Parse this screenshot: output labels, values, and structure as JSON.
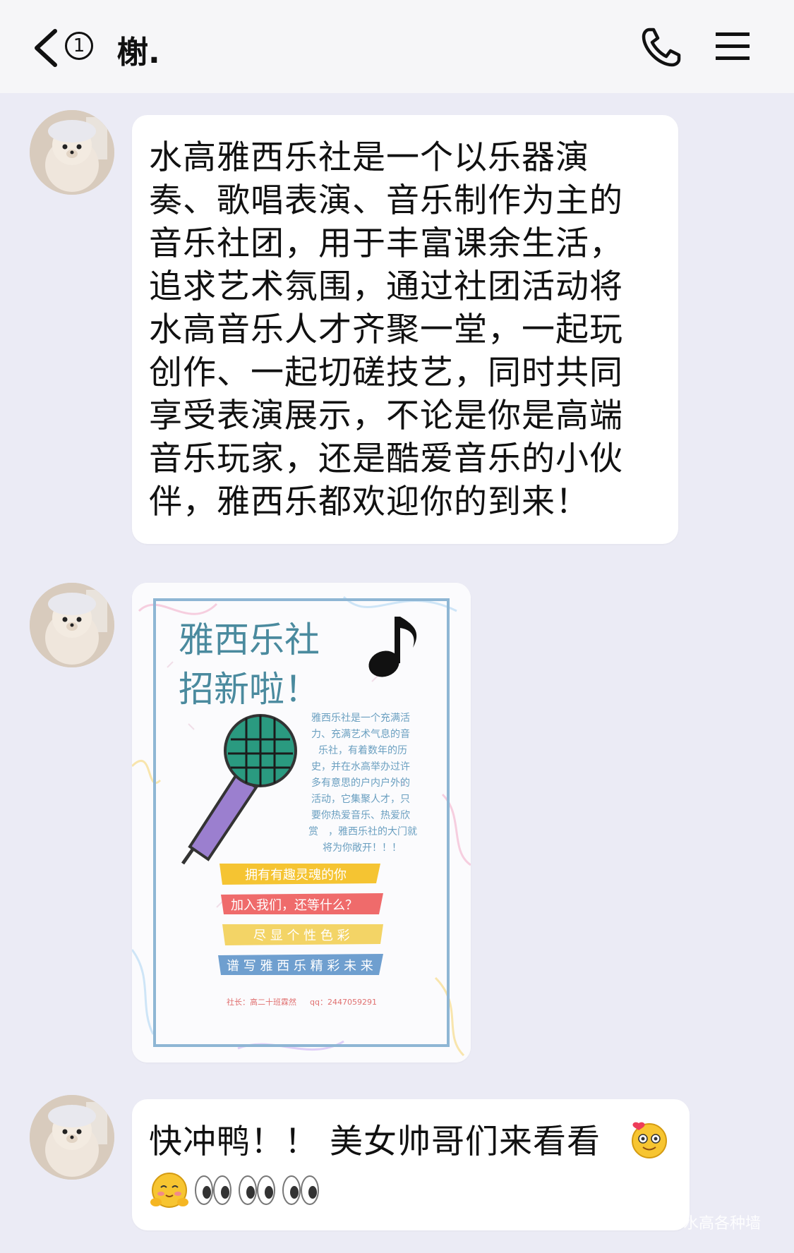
{
  "header": {
    "unread_count": "1",
    "title": "榭."
  },
  "messages": [
    {
      "type": "text",
      "lines": [
        "水高雅西乐社是一个以乐器演",
        "奏、歌唱表演、音乐制作为主的",
        "音乐社团，用于丰富课余生活，",
        "追求艺术氛围，通过社团活动将",
        "水高音乐人才齐聚一堂，一起玩",
        "创作、一起切磋技艺，同时共同",
        "享受表演展示，不论是你是高端",
        "音乐玩家，还是酷爱音乐的小伙",
        "伴，雅西乐都欢迎你的到来！"
      ]
    },
    {
      "type": "image",
      "poster": {
        "title_line1": "雅西乐社",
        "title_line2": "招新啦！",
        "intro_lines": [
          "雅西乐社是一个充满活",
          "力、充满艺术气息的音",
          "乐社，有着数年的历",
          "史，并在水高举办过许",
          "多有意思的户内户外的",
          "活动，它集聚人才，只",
          "要你热爱音乐、热爱欣",
          "赏　，雅西乐社的大门就",
          "将为你敞开！！！"
        ],
        "ribbons": [
          {
            "text": "拥有有趣灵魂的你",
            "color": "#f5c432"
          },
          {
            "text": "加入我们，还等什么？",
            "color": "#ef6b6b"
          },
          {
            "text": "尽 显 个 性 色 彩",
            "color": "#f3d466"
          },
          {
            "text": "谱 写 雅 西 乐 精 彩 未 来",
            "color": "#6f9fcf"
          }
        ],
        "footer_left": "社长：高二十班霖然",
        "footer_right": "qq：2447059291",
        "frame_color": "#8eb6d4",
        "mic_head_color": "#2a9a80",
        "mic_body_color": "#9b7fcf"
      }
    },
    {
      "type": "text",
      "text": "快冲鸭！！ 美女帅哥们来看看",
      "emojis": [
        "face-with-hands-emoji",
        "smiling-face-emoji",
        "eyes-emoji",
        "eyes-emoji",
        "eyes-emoji"
      ]
    }
  ],
  "watermark": "水高各种墙",
  "colors": {
    "background": "#ebebf5",
    "header_background": "#f6f6f8",
    "bubble": "#ffffff"
  }
}
